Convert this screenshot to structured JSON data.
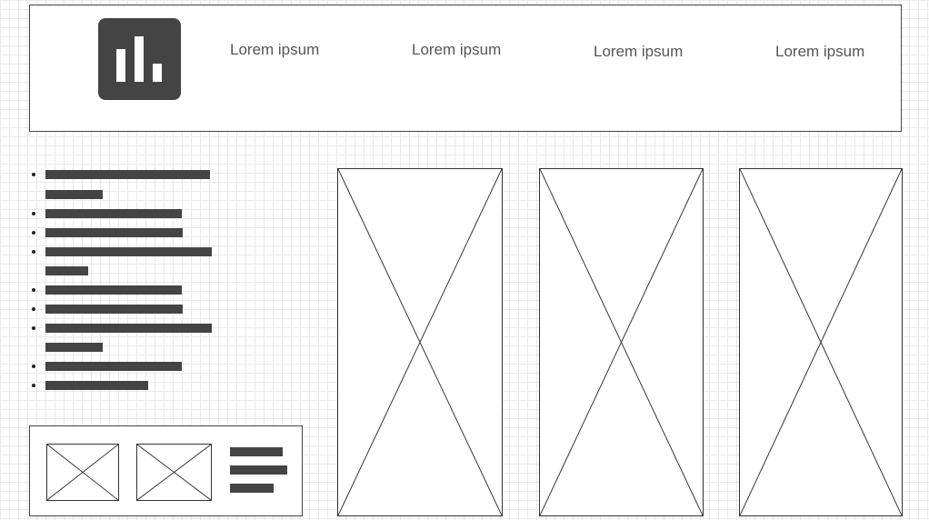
{
  "header": {
    "logo_icon": "bar-chart-icon",
    "nav": [
      {
        "label": "Lorem ipsum"
      },
      {
        "label": "Lorem ipsum"
      },
      {
        "label": "Lorem ipsum"
      },
      {
        "label": "Lorem ipsum"
      }
    ]
  },
  "sidebar": {
    "bullet_items": 9
  },
  "gallery": {
    "image_icon": "image-placeholder-icon",
    "count": 3
  },
  "card": {
    "image_icon": "image-placeholder-icon",
    "thumbnails": 2
  },
  "colors": {
    "bar": "#444444",
    "line": "#333333",
    "grid": "#e9e9e9"
  }
}
